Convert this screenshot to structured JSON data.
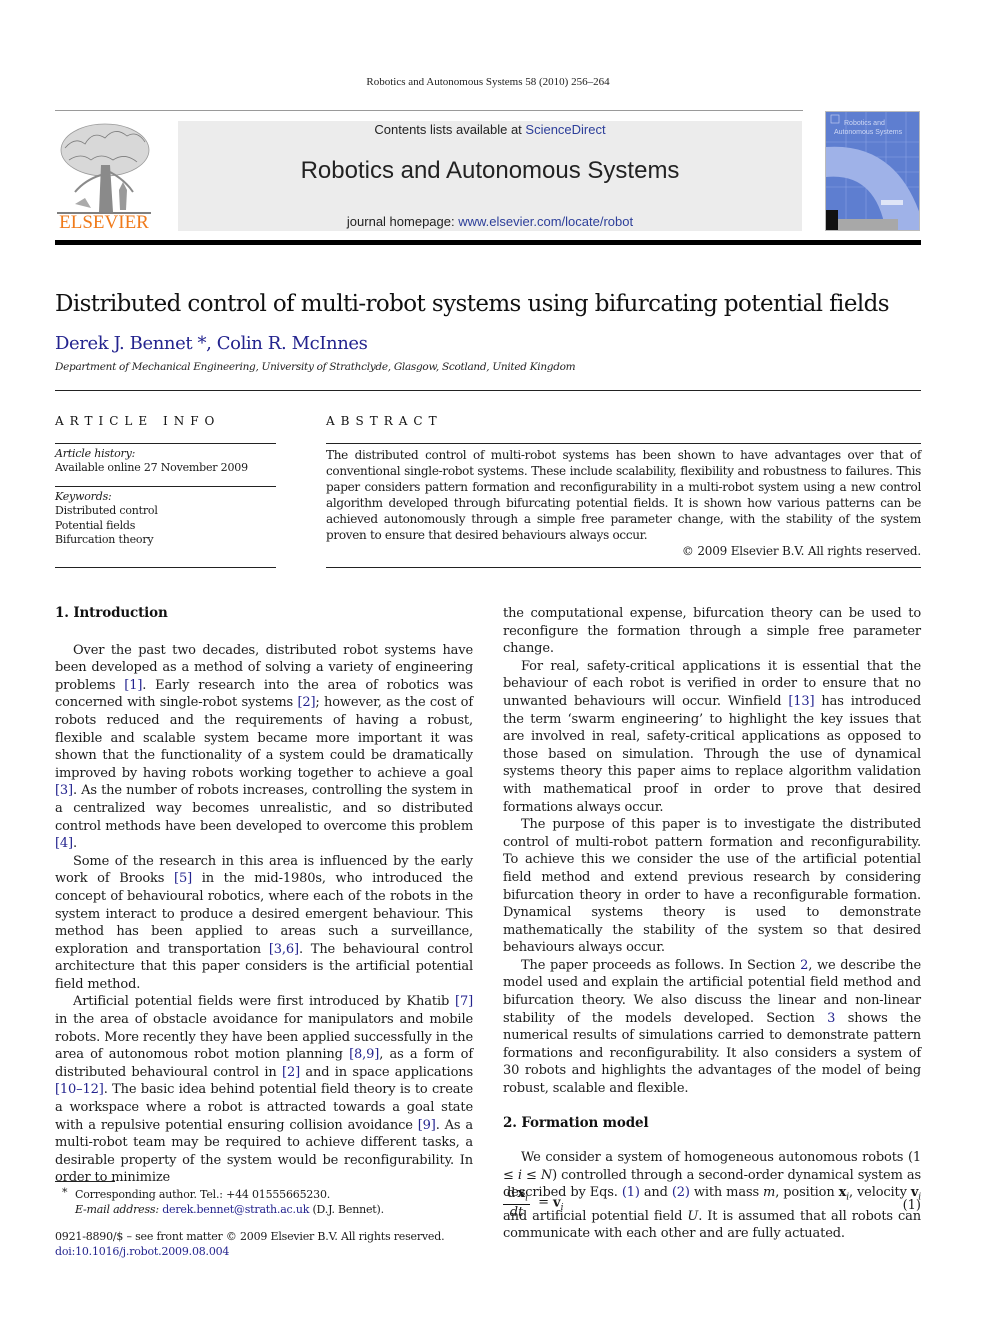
{
  "header": {
    "running_head": "Robotics and Autonomous Systems 58 (2010) 256–264",
    "contents_prefix": "Contents lists available at ",
    "contents_link": "ScienceDirect",
    "journal_title": "Robotics and Autonomous Systems",
    "homepage_prefix": "journal homepage: ",
    "homepage_link": "www.elsevier.com/locate/robot",
    "publisher_logo_text": "ELSEVIER",
    "cover_title_line1": "Robotics and",
    "cover_title_line2": "Autonomous Systems",
    "colors": {
      "elsevier_orange": "#f07a1a",
      "link_blue": "#23238e",
      "cover_blue": "#5e7ed0"
    }
  },
  "article": {
    "title": "Distributed control of multi-robot systems using bifurcating potential fields",
    "authors": [
      {
        "name": "Derek J. Bennet",
        "mark": " *"
      },
      {
        "name": "Colin R. McInnes",
        "mark": ""
      }
    ],
    "author_separator": ", ",
    "affiliation": "Department of Mechanical Engineering, University of Strathclyde, Glasgow, Scotland, United Kingdom"
  },
  "article_info": {
    "heading": "ARTICLE INFO",
    "history_label": "Article history:",
    "history_value": "Available online 27 November 2009",
    "keywords_label": "Keywords:",
    "keywords": [
      "Distributed control",
      "Potential fields",
      "Bifurcation theory"
    ]
  },
  "abstract": {
    "heading": "ABSTRACT",
    "text": "The distributed control of multi-robot systems has been shown to have advantages over that of conventional single-robot systems. These include scalability, flexibility and robustness to failures. This paper considers pattern formation and reconfigurability in a multi-robot system using a new control algorithm developed through bifurcating potential fields. It is shown how various patterns can be achieved autonomously through a simple free parameter change, with the stability of the system proven to ensure that desired behaviours always occur.",
    "copyright": "© 2009 Elsevier B.V. All rights reserved."
  },
  "body": {
    "sec1_heading": "1.  Introduction",
    "p1": [
      "Over the past two decades, distributed robot systems have been developed as a method of solving a variety of engineering problems ",
      "[1]",
      ". Early research into the area of robotics was concerned with single-robot systems ",
      "[2]",
      "; however, as the cost of robots reduced and the requirements of having a robust, flexible and scalable system became more important it was shown that the functionality of a system could be dramatically improved by having robots working together to achieve a goal ",
      "[3]",
      ". As the number of robots increases, controlling the system in a centralized way becomes unrealistic, and so distributed control methods have been developed to overcome this problem ",
      "[4]",
      "."
    ],
    "p2": [
      "Some of the research in this area is influenced by the early work of Brooks ",
      "[5]",
      " in the mid-1980s, who introduced the concept of behavioural robotics, where each of the robots in the system interact to produce a desired emergent behaviour. This method has been applied to areas such a surveillance, exploration and transportation ",
      "[3,6]",
      ". The behavioural control architecture that this paper considers is the artificial potential field method."
    ],
    "p3": [
      "Artificial potential fields were first introduced by Khatib ",
      "[7]",
      " in the area of obstacle avoidance for manipulators and mobile robots. More recently they have been applied successfully in the area of autonomous robot motion planning ",
      "[8,9]",
      ", as a form of distributed behavioural control in ",
      "[2]",
      " and in space applications ",
      "[10–12]",
      ". The basic idea behind potential field theory is to create a workspace where a robot is attracted towards a goal state with a repulsive potential ensuring collision avoidance ",
      "[9]",
      ". As a multi-robot team may be required to achieve different tasks, a desirable property of the system would be reconfigurability. In order to minimize"
    ],
    "p4_cont": "the computational expense, bifurcation theory can be used to reconfigure the formation through a simple free parameter change.",
    "p5": [
      "For real, safety-critical applications it is essential that the behaviour of each robot is verified in order to ensure that no unwanted behaviours will occur. Winfield ",
      "[13]",
      " has introduced the term ‘swarm engineering’ to highlight the key issues that are involved in real, safety-critical applications as opposed to those based on simulation. Through the use of dynamical systems theory this paper aims to replace algorithm validation with mathematical proof in order to prove that desired formations always occur."
    ],
    "p6": "The purpose of this paper is to investigate the distributed control of multi-robot pattern formation and reconfigurability. To achieve this we consider the use of the artificial potential field method and extend previous research by considering bifurcation theory in order to have a reconfigurable formation. Dynamical systems theory is used to demonstrate mathematically the stability of the system so that desired behaviours always occur.",
    "p7": [
      "The paper proceeds as follows. In Section ",
      "2",
      ", we describe the model used and explain the artificial potential field method and bifurcation theory. We also discuss the linear and non-linear stability of the models developed. Section ",
      "3",
      " shows the numerical results of simulations carried to demonstrate pattern formations and reconfigurability. It also considers a system of 30 robots and highlights the advantages of the model of being robust, scalable and flexible."
    ],
    "sec2_heading": "2.  Formation model",
    "p8": {
      "a": "We consider a system of homogeneous autonomous robots (1 ≤ ",
      "i": "i",
      "b": " ≤ ",
      "N": "N",
      "c": ") controlled through a second-order dynamical system as described by Eqs. ",
      "eq1": "(1)",
      "d": " and ",
      "eq2": "(2)",
      "e": " with mass ",
      "m": "m",
      "f": ", position ",
      "x": "x",
      "g": ", velocity ",
      "v": "v",
      "h": " and artificial potential field ",
      "U": "U",
      "j": ". It is assumed that all robots can communicate with each other and are fully actuated."
    },
    "equation1": {
      "num_d": "d",
      "num_x": "x",
      "sub": "i",
      "den": "dt",
      "rhs_eq": "=",
      "rhs_v": "v",
      "label": "(1)"
    }
  },
  "footnotes": {
    "star": "*",
    "corresponding": "Corresponding author. Tel.: +44 01555665230.",
    "email_label": "E-mail address:",
    "email": "derek.bennet@strath.ac.uk",
    "email_suffix": " (D.J. Bennet).",
    "issn_line": "0921-8890/$ – see front matter © 2009 Elsevier B.V. All rights reserved.",
    "doi": "doi:10.1016/j.robot.2009.08.004"
  }
}
